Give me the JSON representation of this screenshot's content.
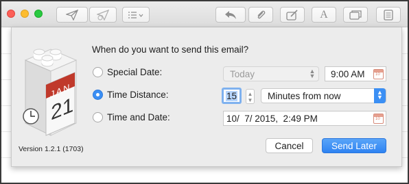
{
  "toolbar": {
    "buttons": [
      {
        "name": "send-icon"
      },
      {
        "name": "send-later-icon"
      },
      {
        "name": "list-format-icon"
      },
      {
        "name": "reply-icon"
      },
      {
        "name": "attach-icon"
      },
      {
        "name": "compose-icon"
      },
      {
        "name": "font-icon",
        "glyph": "A"
      },
      {
        "name": "window-icon"
      },
      {
        "name": "document-icon"
      }
    ]
  },
  "dialog": {
    "question": "When do you want to send this email?",
    "options": {
      "special_date": {
        "label": "Special Date:",
        "selected": false,
        "date_popup": "Today",
        "time": "9:00 AM"
      },
      "time_distance": {
        "label": "Time Distance:",
        "selected": true,
        "amount": "15",
        "unit_popup": "Minutes from now"
      },
      "time_and_date": {
        "label": "Time and Date:",
        "selected": false,
        "datetime": "10/  7/ 2015,  2:49 PM"
      }
    },
    "app_icon": {
      "month": "JAN",
      "day": "21"
    },
    "version": "Version 1.2.1 (1703)",
    "cancel_label": "Cancel",
    "send_later_label": "Send Later"
  },
  "colors": {
    "accent": "#3b8ff4",
    "calendar_red": "#c0392b"
  }
}
